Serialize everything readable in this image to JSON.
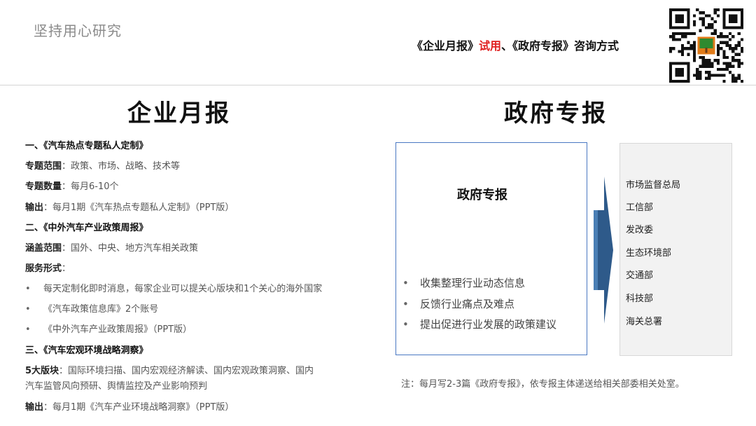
{
  "header": {
    "brand": "坚持用心研究",
    "title_part1": "《企业月报》",
    "title_highlight": "试用",
    "title_part2": "、《政府专报》咨询方式",
    "qr_label": "qr-code"
  },
  "left": {
    "title": "企业月报",
    "s1": {
      "heading": "一、《汽车热点专题私人定制》"
    },
    "s1_scope": {
      "label": "专题范围",
      "text": "：政策、市场、战略、技术等"
    },
    "s1_count": {
      "label": "专题数量",
      "text": "：每月6-10个"
    },
    "s1_output": {
      "label": "输出",
      "text": "：每月1期《汽车热点专题私人定制》（PPT版）"
    },
    "s2": {
      "heading": "二、《中外汽车产业政策周报》"
    },
    "s2_scope": {
      "label": "涵盖范围",
      "text": "：国外、中央、地方汽车相关政策"
    },
    "s2_form": {
      "label": "服务形式",
      "text": "："
    },
    "s2_bullets": [
      "每天定制化即时消息，每家企业可以提关心版块和1个关心的海外国家",
      "《汽车政策信息库》2个账号",
      "《中外汽车产业政策周报》（PPT版）"
    ],
    "s3": {
      "heading": "三、《汽车宏观环境战略洞察》"
    },
    "s3_blocks": {
      "label": "5大版块",
      "text": "：国际环境扫描、国内宏观经济解读、国内宏观政策洞察、国内",
      "text2": "汽车监管风向预研、舆情监控及产业影响预判"
    },
    "s3_output": {
      "label": "输出",
      "text": "：每月1期《汽车产业环境战略洞察》（PPT版）"
    }
  },
  "right": {
    "title": "政府专报",
    "box_title": "政府专报",
    "bullets": [
      "收集整理行业动态信息",
      "反馈行业痛点及难点",
      "提出促进行业发展的政策建议"
    ],
    "departments": [
      "市场监督总局",
      "工信部",
      "发改委",
      "生态环境部",
      "交通部",
      "科技部",
      "海关总署"
    ],
    "note": "注：每月写2-3篇《政府专报》，依专报主体递送给相关部委相关处室。"
  },
  "colors": {
    "highlight": "#e02020",
    "box_border": "#4a78c2",
    "arrow": "#2e5a8a"
  },
  "bullet_char": "•"
}
